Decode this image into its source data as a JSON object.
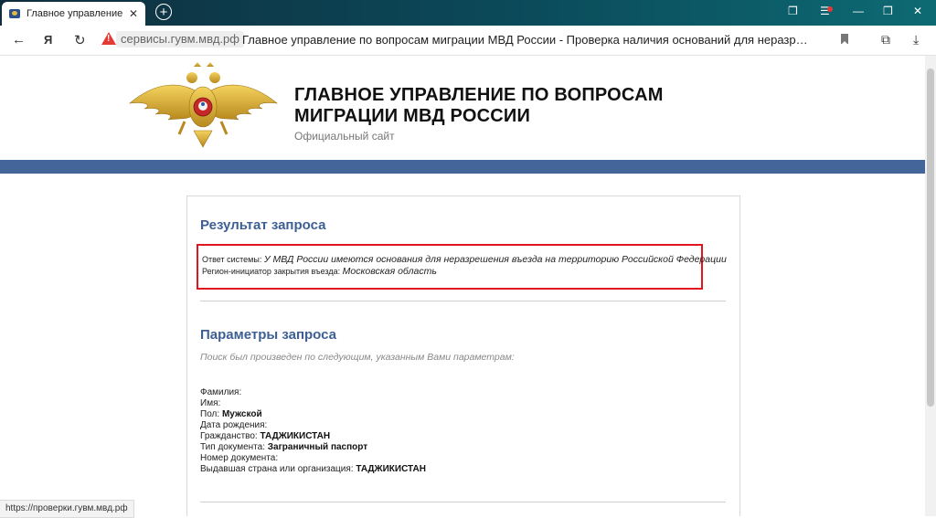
{
  "browser": {
    "tab_title": "Главное управление по",
    "tab_close": "✕",
    "new_tab": "+",
    "back": "←",
    "yandex": "Я",
    "reload": "↻",
    "url_domain": "сервисы.гувм.мвд.рф",
    "page_title": "Главное управление по вопросам миграции МВД России - Проверка наличия оснований для неразрешен…",
    "status_url": "https://проверки.гувм.мвд.рф"
  },
  "header": {
    "title_line1": "ГЛАВНОЕ УПРАВЛЕНИЕ ПО ВОПРОСАМ",
    "title_line2": "МИГРАЦИИ МВД РОССИИ",
    "subtitle": "Официальный сайт"
  },
  "result": {
    "heading": "Результат запроса",
    "system_label": "Ответ системы:",
    "system_value": "У МВД России имеются основания для неразрешения въезда на территорию Российской Федерации",
    "region_label": "Регион-инициатор закрытия въезда:",
    "region_value": "Московская область"
  },
  "params": {
    "heading": "Параметры запроса",
    "note": "Поиск был произведен по следующим, указанным Вами параметрам:",
    "surname_label": "Фамилия:",
    "name_label": "Имя:",
    "sex_label": "Пол:",
    "sex_value": "Мужской",
    "birth_label": "Дата рождения:",
    "citizenship_label": "Гражданство:",
    "citizenship_value": "ТАДЖИКИСТАН",
    "doc_type_label": "Тип документа:",
    "doc_type_value": "Заграничный паспорт",
    "doc_number_label": "Номер документа:",
    "issuer_label": "Выдавшая страна или организация:",
    "issuer_value": "ТАДЖИКИСТАН"
  },
  "colors": {
    "accent_blue": "#44659a",
    "heading_blue": "#3d5f93",
    "highlight_red": "#e0151d"
  }
}
